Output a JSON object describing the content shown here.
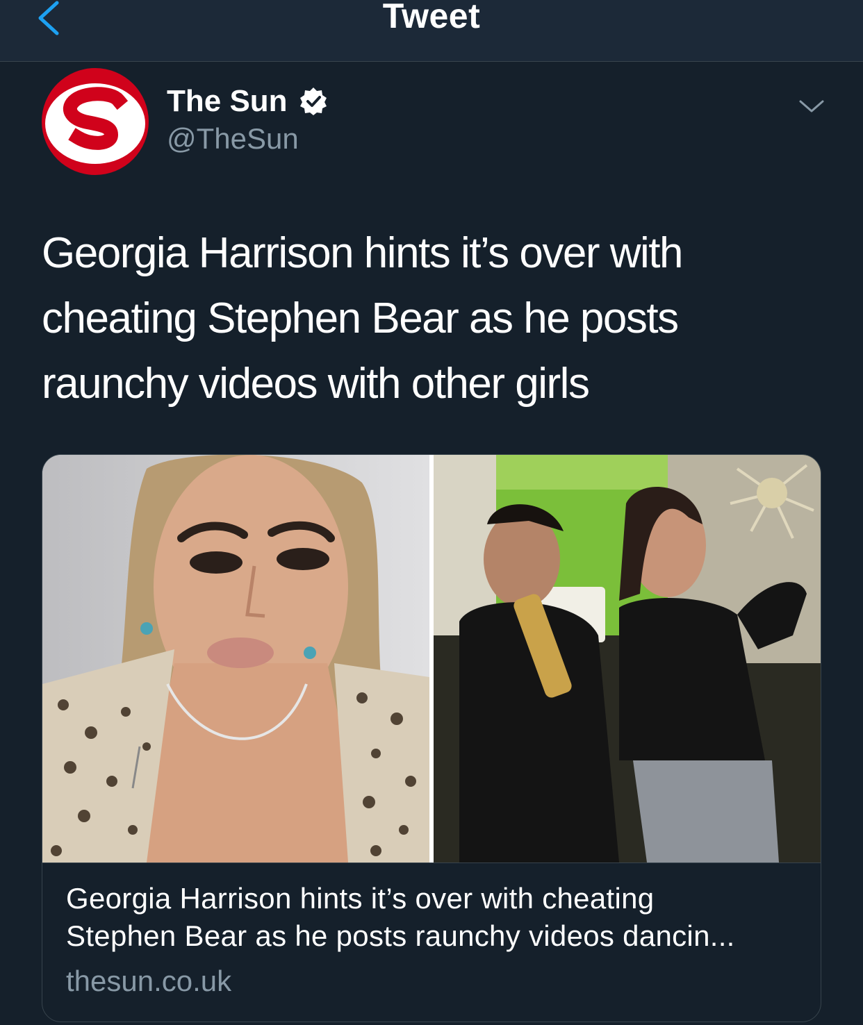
{
  "navbar": {
    "title": "Tweet",
    "back_icon": "chevron-left-icon"
  },
  "author": {
    "name": "The Sun",
    "handle": "@TheSun",
    "verified": true,
    "avatar_letter": "S",
    "avatar_colors": {
      "ring": "#d0021b",
      "inner": "#ffffff",
      "letter": "#d0021b"
    }
  },
  "tweet": {
    "lines": [
      "Georgia Harrison hints it’s over with",
      "cheating Stephen Bear as he posts",
      "raunchy videos with other girls"
    ]
  },
  "card": {
    "title_lines": [
      "Georgia Harrison hints it’s over with cheating",
      "Stephen Bear as he posts raunchy videos dancin..."
    ],
    "domain": "thesun.co.uk"
  },
  "colors": {
    "background": "#15202b",
    "navbar": "#1c2938",
    "accent": "#1da1f2",
    "secondary_text": "#8899a6",
    "border": "#38444d"
  }
}
